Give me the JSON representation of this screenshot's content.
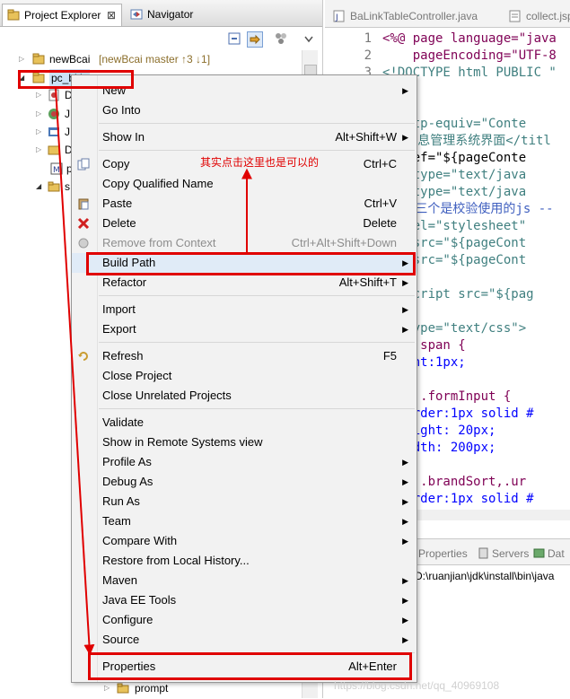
{
  "explorer": {
    "tabs": [
      {
        "label": "Project Explorer",
        "close": "⊠",
        "icon": "project-explorer-icon"
      },
      {
        "label": "Navigator",
        "icon": "navigator-icon"
      }
    ],
    "toolbar": [
      "collapse-all-icon",
      "link-with-editor-icon",
      "filters-icon",
      "view-menu-icon"
    ],
    "tree": [
      {
        "label": "newBcai",
        "suffix": "[newBcai master ↑3 ↓1]",
        "icon": "project-icon"
      },
      {
        "label": "pc_bkic",
        "icon": "project-icon"
      },
      {
        "label": "D",
        "icon": "deployment-descriptor-icon"
      },
      {
        "label": "J",
        "icon": "jaxws-icon"
      },
      {
        "label": "J",
        "icon": "java-resources-icon"
      },
      {
        "label": "D",
        "icon": "deployed-resources-icon"
      },
      {
        "label": "p",
        "icon": "maven-pom-icon"
      },
      {
        "label": "s",
        "icon": "folder-icon"
      },
      {
        "label": "prompt",
        "icon": "folder-icon"
      }
    ]
  },
  "editor": {
    "tabs": [
      {
        "label": "BaLinkTableController.java",
        "icon": "java-file-icon"
      },
      {
        "label": "collect.jsp",
        "icon": "jsp-file-icon"
      }
    ],
    "lines": [
      {
        "num": "1",
        "text": "<%@ page language=\"java",
        "cls": "k"
      },
      {
        "num": "2",
        "text": "    pageEncoding=\"UTF-8",
        "cls": "k"
      },
      {
        "num": "3",
        "text": "<!DOCTYPE html PUBLIC \"",
        "cls": "t"
      },
      {
        "num": "",
        "text": "l>",
        "cls": "t"
      },
      {
        "num": "",
        "text": "d>",
        "cls": "t"
      },
      {
        "num": "",
        "text": "a http-equiv=\"Conte",
        "cls": "t"
      },
      {
        "num": "",
        "text": "le>信息管理系统界面</titl",
        "cls": "t"
      },
      {
        "num": "",
        "text": "k href=\"${pageConte",
        "cls": ""
      },
      {
        "num": "",
        "text": "ipt type=\"text/java",
        "cls": "t"
      },
      {
        "num": "",
        "text": "ipt type=\"text/java",
        "cls": "t"
      },
      {
        "num": "",
        "text": " 以下三个是校验使用的js --",
        "cls": "c"
      },
      {
        "num": "",
        "text": "nk rel=\"stylesheet\"",
        "cls": "t"
      },
      {
        "num": "",
        "text": "ipt src=\"${pageCont",
        "cls": "t"
      },
      {
        "num": "",
        "text": "ipt src=\"${pageCont",
        "cls": "t"
      },
      {
        "num": "",
        "text": "",
        "cls": ""
      },
      {
        "num": "",
        "text": "  <script src=\"${pag",
        "cls": "t"
      },
      {
        "num": "",
        "text": "ad>",
        "cls": "t"
      },
      {
        "num": "",
        "text": "le type=\"text/css\">",
        "cls": "t"
      },
      {
        "num": "",
        "text": "info span {",
        "cls": "k"
      },
      {
        "num": "",
        "text": "height:1px;",
        "cls": "b"
      },
      {
        "num": "",
        "text": "",
        "cls": ""
      },
      {
        "num": "",
        "text": "info .formInput {",
        "cls": "k"
      },
      {
        "num": "",
        "text": "  border:1px solid #",
        "cls": "b"
      },
      {
        "num": "",
        "text": "  height: 20px;",
        "cls": "b"
      },
      {
        "num": "",
        "text": "  width: 200px;",
        "cls": "b"
      },
      {
        "num": "",
        "text": "",
        "cls": ""
      },
      {
        "num": "",
        "text": "info .brandSort,.ur",
        "cls": "k"
      },
      {
        "num": "",
        "text": "  border:1px solid #",
        "cls": "b"
      }
    ]
  },
  "bottom_panel": {
    "tabs": [
      {
        "label": "Properties",
        "icon": "properties-icon"
      },
      {
        "label": "Servers",
        "icon": "servers-icon"
      },
      {
        "label": "Dat",
        "icon": "data-source-icon"
      }
    ],
    "console_path": "D:\\ruanjian\\jdk\\install\\bin\\java"
  },
  "context_menu": {
    "items": [
      {
        "label": "New",
        "shortcut": "",
        "submenu": true
      },
      {
        "label": "Go Into",
        "shortcut": ""
      },
      {
        "sep": true
      },
      {
        "label": "Show In",
        "shortcut": "Alt+Shift+W",
        "submenu": true
      },
      {
        "sep": true
      },
      {
        "label": "Copy",
        "shortcut": "Ctrl+C",
        "icon": "copy-icon"
      },
      {
        "label": "Copy Qualified Name",
        "shortcut": ""
      },
      {
        "label": "Paste",
        "shortcut": "Ctrl+V",
        "icon": "paste-icon"
      },
      {
        "label": "Delete",
        "shortcut": "Delete",
        "icon": "delete-icon"
      },
      {
        "label": "Remove from Context",
        "shortcut": "Ctrl+Alt+Shift+Down",
        "disabled": true,
        "icon": "remove-context-icon"
      },
      {
        "label": "Build Path",
        "shortcut": "",
        "submenu": true
      },
      {
        "label": "Refactor",
        "shortcut": "Alt+Shift+T",
        "submenu": true
      },
      {
        "sep": true
      },
      {
        "label": "Import",
        "shortcut": "",
        "submenu": true
      },
      {
        "label": "Export",
        "shortcut": "",
        "submenu": true
      },
      {
        "sep": true
      },
      {
        "label": "Refresh",
        "shortcut": "F5",
        "icon": "refresh-icon"
      },
      {
        "label": "Close Project",
        "shortcut": ""
      },
      {
        "label": "Close Unrelated Projects",
        "shortcut": ""
      },
      {
        "sep": true
      },
      {
        "label": "Validate",
        "shortcut": ""
      },
      {
        "label": "Show in Remote Systems view",
        "shortcut": ""
      },
      {
        "label": "Profile As",
        "shortcut": "",
        "submenu": true
      },
      {
        "label": "Debug As",
        "shortcut": "",
        "submenu": true
      },
      {
        "label": "Run As",
        "shortcut": "",
        "submenu": true
      },
      {
        "label": "Team",
        "shortcut": "",
        "submenu": true
      },
      {
        "label": "Compare With",
        "shortcut": "",
        "submenu": true
      },
      {
        "label": "Restore from Local History...",
        "shortcut": ""
      },
      {
        "label": "Maven",
        "shortcut": "",
        "submenu": true
      },
      {
        "label": "Java EE Tools",
        "shortcut": "",
        "submenu": true
      },
      {
        "label": "Configure",
        "shortcut": "",
        "submenu": true
      },
      {
        "label": "Source",
        "shortcut": "",
        "submenu": true
      },
      {
        "sep": true
      },
      {
        "label": "Properties",
        "shortcut": "Alt+Enter"
      }
    ]
  },
  "annotation": {
    "note": "其实点击这里也是可以的",
    "color": "#e00000"
  },
  "watermark": "https://blog.csdn.net/qq_40969108"
}
